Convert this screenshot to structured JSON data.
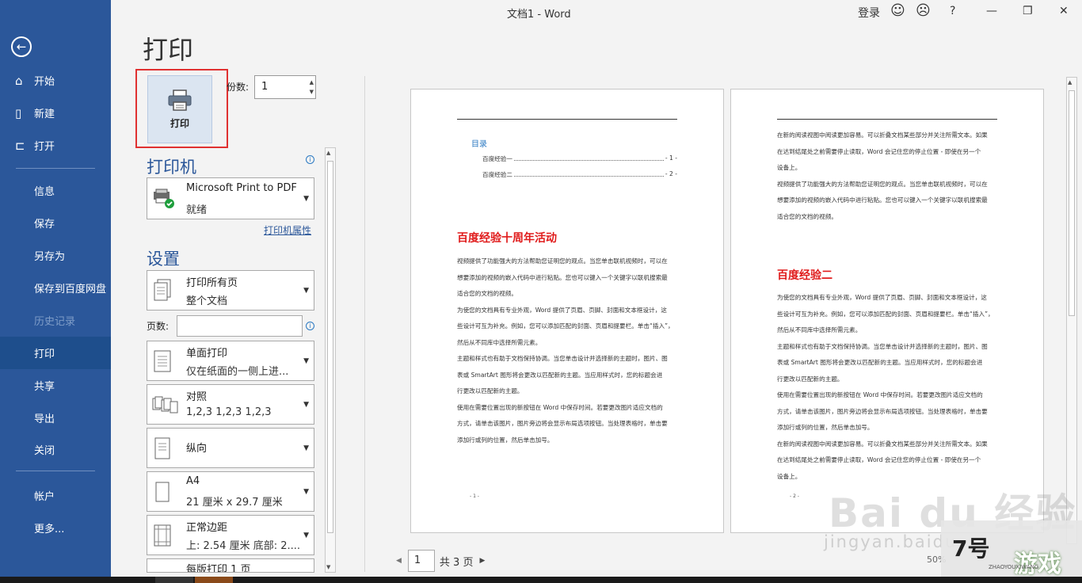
{
  "window": {
    "title": "文档1  -  Word",
    "login": "登录",
    "smile_icon": "☺",
    "frown_icon": "☹",
    "help": "?",
    "minimize": "—",
    "restore": "❐",
    "close": "✕"
  },
  "nav": {
    "back_icon": "←",
    "items": [
      {
        "icon": "⌂",
        "label": "开始"
      },
      {
        "icon": "▯",
        "label": "新建"
      },
      {
        "icon": "⊏",
        "label": "打开"
      },
      {
        "label": "信息"
      },
      {
        "label": "保存"
      },
      {
        "label": "另存为"
      },
      {
        "label": "保存到百度网盘"
      },
      {
        "label": "历史记录"
      },
      {
        "label": "打印"
      },
      {
        "label": "共享"
      },
      {
        "label": "导出"
      },
      {
        "label": "关闭"
      },
      {
        "label": "帐户"
      },
      {
        "label": "更多..."
      }
    ]
  },
  "print": {
    "title": "打印",
    "button": "打印",
    "copies_label": "份数:",
    "copies_value": "1",
    "printer_title": "打印机",
    "printer_name": "Microsoft Print to PDF",
    "printer_status": "就绪",
    "printer_props": "打印机属性",
    "settings_title": "设置",
    "pages_label": "页数:",
    "pages_value": "",
    "options": [
      {
        "line1": "打印所有页",
        "line2": "整个文档"
      },
      {
        "line1": "单面打印",
        "line2": "仅在纸面的一侧上进..."
      },
      {
        "line1": "对照",
        "line2": "1,2,3     1,2,3     1,2,3"
      },
      {
        "line1": "纵向",
        "line2": ""
      },
      {
        "line1": "A4",
        "line2": "21 厘米 x 29.7 厘米"
      },
      {
        "line1": "正常边距",
        "line2": "上: 2.54 厘米 底部: 2...."
      },
      {
        "line1": "每版打印 1 页",
        "line2": ""
      }
    ]
  },
  "preview": {
    "page1": {
      "toc_title": "目录",
      "toc": [
        {
          "label": "百度经验一",
          "page": "- 1 -"
        },
        {
          "label": "百度经验二",
          "page": "- 2 -"
        }
      ],
      "heading": "百度经验十周年活动",
      "paragraphs": [
        "视频提供了功能强大的方法帮助您证明您的观点。当您单击联机视频时，可以在",
        "想要添加的视频的嵌入代码中进行粘贴。您也可以键入一个关键字以联机搜索最",
        "适合您的文档的视频。",
        "为使您的文档具有专业外观，Word 提供了页眉、页脚、封面和文本框设计，这",
        "些设计可互为补充。例如，您可以添加匹配的封面、页眉和提要栏。单击“插入”，",
        "然后从不同库中选择所需元素。",
        "主题和样式也有助于文档保持协调。当您单击设计并选择新的主题时，图片、图",
        "表或 SmartArt 图形将会更改以匹配新的主题。当应用样式时，您的标题会进",
        "行更改以匹配新的主题。",
        "使用在需要位置出现的新按钮在 Word 中保存时间。若要更改图片适应文档的",
        "方式，请单击该图片，图片旁边将会显示布局选项按钮。当处理表格时，单击要",
        "添加行或列的位置，然后单击加号。"
      ],
      "page_number": "- 1 -"
    },
    "page2": {
      "top_paragraphs": [
        "在新的阅读视图中阅读更加容易。可以折叠文档某些部分并关注所需文本。如果",
        "在达到结尾处之前需要停止读取，Word 会记住您的停止位置 - 即使在另一个",
        "设备上。",
        "视频提供了功能强大的方法帮助您证明您的观点。当您单击联机视频时，可以在",
        "想要添加的视频的嵌入代码中进行粘贴。您也可以键入一个关键字以联机搜索最",
        "适合您的文档的视频。"
      ],
      "heading": "百度经验二",
      "paragraphs": [
        "为使您的文档具有专业外观，Word 提供了页眉、页脚、封面和文本框设计，这",
        "些设计可互为补充。例如，您可以添加匹配的封面、页眉和提要栏。单击“插入”，",
        "然后从不同库中选择所需元素。",
        "主题和样式也有助于文档保持协调。当您单击设计并选择新的主题时，图片、图",
        "表或 SmartArt 图形将会更改以匹配新的主题。当应用样式时，您的标题会进",
        "行更改以匹配新的主题。",
        "使用在需要位置出现的新按钮在 Word 中保存时间。若要更改图片适应文档的",
        "方式，请单击该图片，图片旁边将会显示布局选项按钮。当处理表格时，单击要",
        "添加行或列的位置，然后单击加号。",
        "在新的阅读视图中阅读更加容易。可以折叠文档某些部分并关注所需文本。如果",
        "在达到结尾处之前需要停止读取，Word 会记住您的停止位置 - 即使在另一个",
        "设备上。"
      ],
      "page_number": "- 2 -"
    },
    "pager": {
      "current": "1",
      "total": "共 3 页"
    },
    "zoom": "50%"
  },
  "watermark": {
    "baidu": "Bai du 经验",
    "jingyan": "jingyan.baidu",
    "game_left": "7号",
    "game_right": "游戏",
    "game_small": "ZHAOYOUXIWANG"
  },
  "colors": {
    "nav": "#2b579a",
    "accent_red": "#e01b1b",
    "link": "#2b579a"
  }
}
